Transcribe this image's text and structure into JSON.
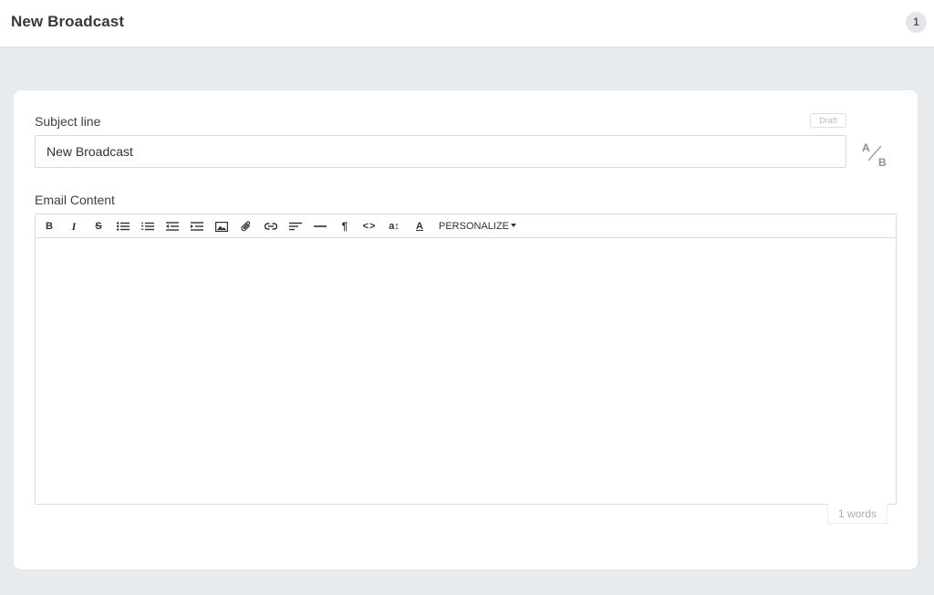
{
  "header": {
    "title": "New Broadcast",
    "step": "1"
  },
  "form": {
    "subject_label": "Subject line",
    "subject_value": "New Broadcast",
    "status_badge": "Draft",
    "ab_test": {
      "a": "A",
      "b": "B"
    },
    "content_label": "Email Content",
    "word_count": "1 words"
  },
  "toolbar": {
    "buttons": [
      {
        "name": "bold",
        "glyph": "B"
      },
      {
        "name": "italic",
        "glyph": "I"
      },
      {
        "name": "strikethrough",
        "glyph": "S"
      },
      {
        "name": "bullet-list",
        "icon": "bullet-list-icon"
      },
      {
        "name": "numbered-list",
        "icon": "numbered-list-icon"
      },
      {
        "name": "outdent",
        "icon": "outdent-icon"
      },
      {
        "name": "indent",
        "icon": "indent-icon"
      },
      {
        "name": "image",
        "icon": "image-icon"
      },
      {
        "name": "attachment",
        "icon": "paperclip-icon"
      },
      {
        "name": "link",
        "icon": "link-icon"
      },
      {
        "name": "align",
        "icon": "align-left-icon"
      },
      {
        "name": "horizontal-rule",
        "icon": "horizontal-rule-icon"
      },
      {
        "name": "paragraph",
        "glyph": "¶"
      },
      {
        "name": "code",
        "glyph": "<>"
      },
      {
        "name": "font-size",
        "glyph": "a↕"
      },
      {
        "name": "font-color",
        "glyph": "A"
      }
    ],
    "personalize_label": "PERSONALIZE"
  }
}
